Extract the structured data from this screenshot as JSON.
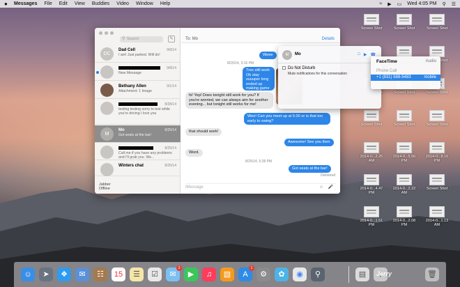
{
  "menubar": {
    "apple": "",
    "items": [
      "Messages",
      "File",
      "Edit",
      "View",
      "Buddies",
      "Video",
      "Window",
      "Help"
    ],
    "clock": "Wed 4:05 PM"
  },
  "desktop": {
    "icons": [
      {
        "label": "Screen Shot"
      },
      {
        "label": "Screen Shot"
      },
      {
        "label": "Screen Shot"
      },
      {
        "label": "Screen Shot"
      },
      {
        "label": "Screen Shot"
      },
      {
        "label": "Screen Shot"
      },
      {
        "label": "Screen Shot"
      },
      {
        "label": "Screen Shot"
      },
      {
        "label": "Screen Shot"
      },
      {
        "label": "Screen Shot"
      },
      {
        "label": "Screen Shot"
      },
      {
        "label": "Screen Shot"
      },
      {
        "label": "2014-0...2.25 AM"
      },
      {
        "label": "2014-0...5.56 PM"
      },
      {
        "label": "2014-0...8.16 PM"
      },
      {
        "label": "2014-0...4.47 PM"
      },
      {
        "label": "2014-0...2.22 AM"
      },
      {
        "label": "Screen Shot"
      },
      {
        "label": "2014-0...1.51 PM"
      },
      {
        "label": "2014-0...2.08 PM"
      },
      {
        "label": "2014-0...1.13 AM"
      }
    ]
  },
  "sidebar": {
    "search_placeholder": "Search",
    "conversations": [
      {
        "name": "Dad Cell",
        "date": "9/9/14",
        "preview": "I am! Just parked. Will do!",
        "avatar": "DC"
      },
      {
        "name": "",
        "date": "9/8/14",
        "preview": "New Message",
        "avatar": ""
      },
      {
        "name": "Bethany Allen",
        "date": "9/1/14",
        "preview": "Attachment: 1 Image",
        "avatar": ""
      },
      {
        "name": "",
        "date": "8/28/14",
        "preview": "testing testing sorry to test while you're driving I love you",
        "avatar": ""
      },
      {
        "name": "Mo",
        "date": "8/25/14",
        "preview": "Got seats at the bar!",
        "avatar": "M"
      },
      {
        "name": "",
        "date": "8/25/14",
        "preview": "Call me if you have any problems and I'll grab you. We...",
        "avatar": ""
      },
      {
        "name": "Winters chat",
        "date": "8/25/14",
        "preview": "",
        "avatar": ""
      }
    ],
    "footer_name": "Jabber",
    "footer_status": "Offline"
  },
  "chat": {
    "to_label": "To:",
    "to_value": "Mo",
    "details_label": "Details",
    "timestamp1": "8/25/14, 3:16 PM",
    "timestamp2": "8/25/14, 5:28 PM",
    "messages": [
      {
        "dir": "out",
        "text": "Weee"
      },
      {
        "dir": "out",
        "text": "Tres still work Ok stay suuuper long ended up making game tonight, wh"
      },
      {
        "dir": "in",
        "text": "hi! Yep! Does tonight still work for you? If you're worried, we can always aim for another evening... but tonight still works for me!"
      },
      {
        "dir": "out",
        "text": "Wee! Can you meet up at 5:30 or is that too early to swing?"
      },
      {
        "dir": "in",
        "text": "that should work!"
      },
      {
        "dir": "out",
        "text": "Awesome! See you then"
      },
      {
        "dir": "in",
        "text": "Word."
      },
      {
        "dir": "out",
        "text": "Got seats at the bar!"
      }
    ],
    "delivered": "Delivered",
    "input_placeholder": "iMessage"
  },
  "details_popover": {
    "name": "Mo",
    "avatar": "M",
    "dnd_label": "Do Not Disturb",
    "dnd_desc": "Mute notifications for this conversation"
  },
  "facetime_menu": {
    "title": "FaceTime",
    "audio": "Audio",
    "phone_call": "Phone Call",
    "number": "+1 (831) 588-5483",
    "number_type": "mobile"
  },
  "dock": {
    "calendar_day": "15",
    "mail_badge": "3",
    "appstore_badge": "1",
    "watermark": "Jerry"
  }
}
